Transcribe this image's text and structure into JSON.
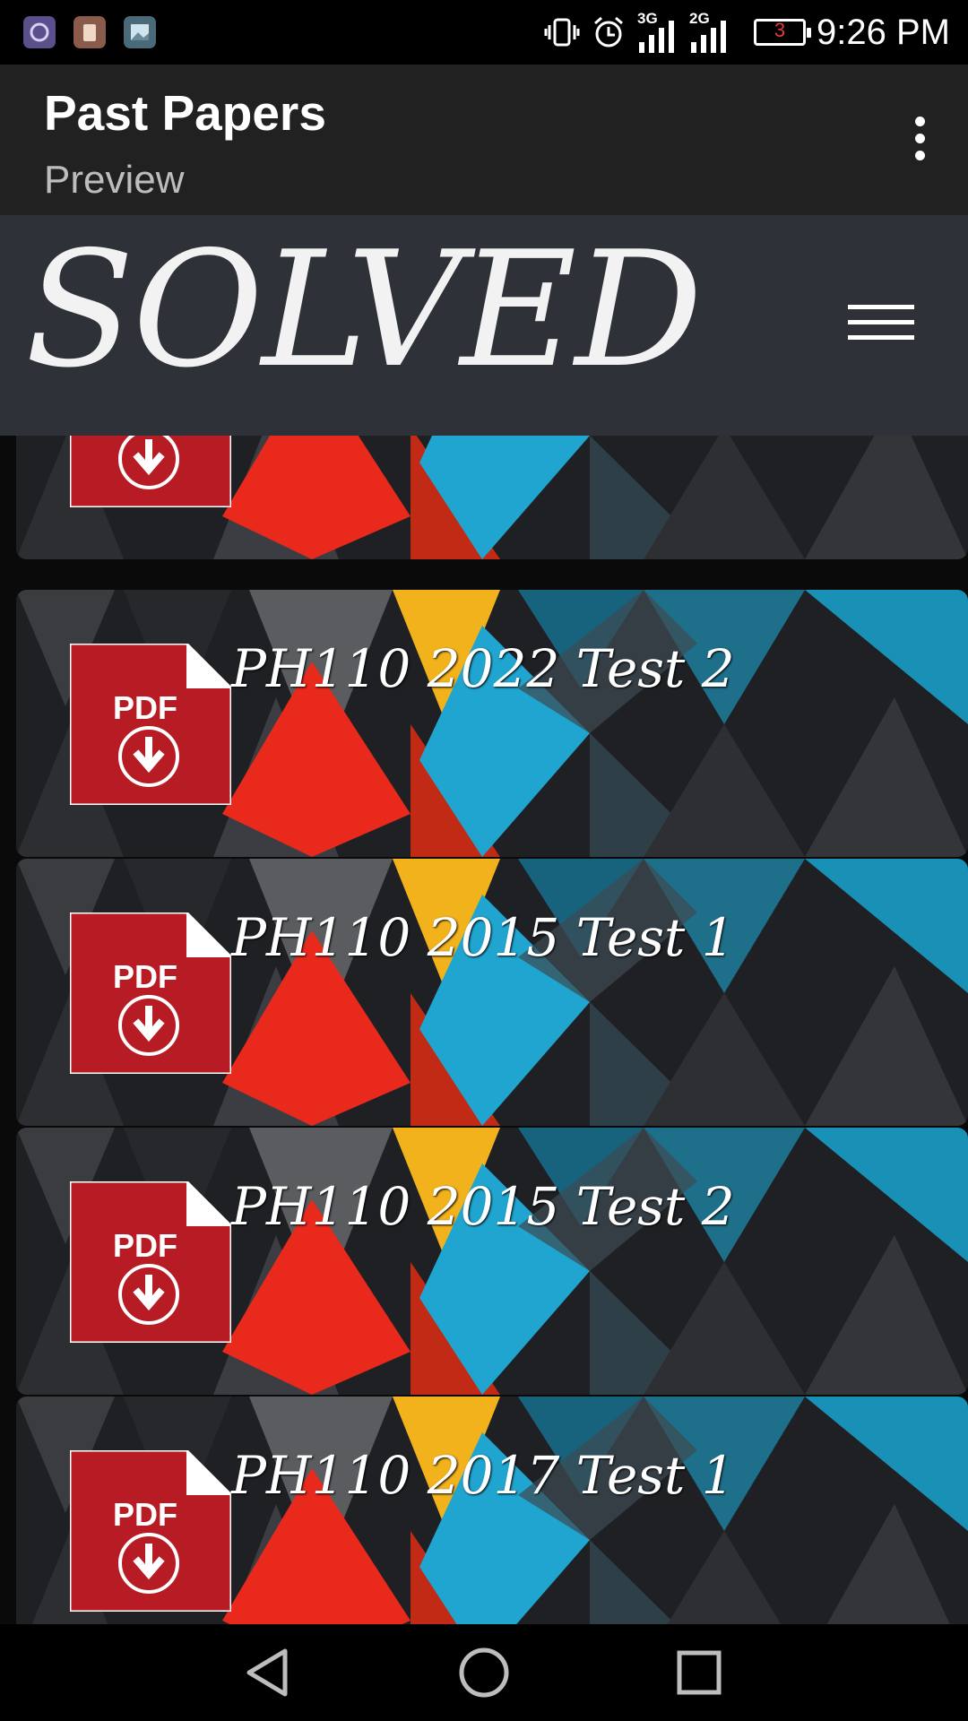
{
  "status_bar": {
    "time": "9:26 PM",
    "network_1": "3G",
    "network_2": "2G",
    "battery": "3",
    "notification_icons": [
      "app-icon",
      "clipboard-icon",
      "gallery-icon"
    ],
    "system_icons": [
      "vibrate-icon",
      "alarm-icon",
      "signal-icon",
      "signal-icon",
      "battery-icon"
    ]
  },
  "app_bar": {
    "title": "Past Papers",
    "subtitle": "Preview",
    "menu_icon": "more-vert-icon"
  },
  "web_header": {
    "logo_text": "SOLVED",
    "menu_icon": "hamburger-menu-icon"
  },
  "papers": [
    {
      "title": "",
      "icon": "pdf-download-icon"
    },
    {
      "title": "PH110 2022 Test 2",
      "icon": "pdf-download-icon"
    },
    {
      "title": "PH110 2015 Test 1",
      "icon": "pdf-download-icon"
    },
    {
      "title": "PH110 2015 Test 2",
      "icon": "pdf-download-icon"
    },
    {
      "title": "PH110 2017 Test 1",
      "icon": "pdf-download-icon"
    }
  ],
  "pdf_icon": {
    "label": "PDF",
    "color": "#b71c24"
  },
  "nav_bar": {
    "buttons": [
      "back-icon",
      "home-icon",
      "recents-icon"
    ]
  },
  "colors": {
    "app_bar": "#212121",
    "header": "#2e3238",
    "accent_red": "#e8291c",
    "accent_blue": "#1fa5cf",
    "accent_yellow": "#f2b21c"
  }
}
